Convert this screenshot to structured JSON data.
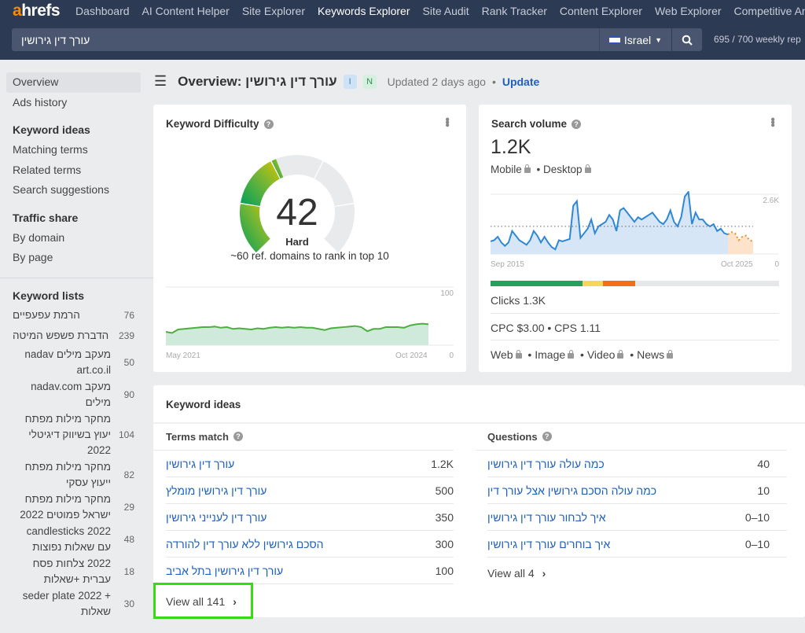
{
  "nav": {
    "logo_a": "a",
    "logo_rest": "hrefs",
    "items": [
      "Dashboard",
      "AI Content Helper",
      "Site Explorer",
      "Keywords Explorer",
      "Site Audit",
      "Rank Tracker",
      "Content Explorer",
      "Web Explorer",
      "Competitive Ana"
    ],
    "active": "Keywords Explorer"
  },
  "search": {
    "value": "עורך דין גירושין",
    "country": "Israel",
    "quota": "695  /  700  weekly rep"
  },
  "sidebar": {
    "top": [
      "Overview",
      "Ads history"
    ],
    "keyword_ideas_heading": "Keyword ideas",
    "keyword_ideas": [
      "Matching terms",
      "Related terms",
      "Search suggestions"
    ],
    "traffic_heading": "Traffic share",
    "traffic": [
      "By domain",
      "By page"
    ],
    "lists_heading": "Keyword lists",
    "lists": [
      {
        "name": "הרמת עפעפיים",
        "count": "76"
      },
      {
        "name": "הדברת פשפש המיטה",
        "count": "239"
      },
      {
        "name": "nadav מעקב מילים art.co.il",
        "count": "50"
      },
      {
        "name": "nadav.com מעקב מילים",
        "count": "90"
      },
      {
        "name": "מחקר מילות מפתח יעוץ בשיווק דיגיטלי 2022",
        "count": "104"
      },
      {
        "name": "מחקר מילות מפתח ייעוץ עסקי",
        "count": "82"
      },
      {
        "name": "מחקר מילות מפתח ישראל פמוטים 2022",
        "count": "29"
      },
      {
        "name": "candlesticks 2022 עם שאלות נפוצות",
        "count": "48"
      },
      {
        "name": "2022 צלחות פסח עברית +שאלות",
        "count": "18"
      },
      {
        "name": "seder plate 2022 + שאלות",
        "count": "30"
      }
    ]
  },
  "header": {
    "title": "Overview: עורך דין גירושין",
    "badge_i": "I",
    "badge_n": "N",
    "updated": "Updated 2 days ago",
    "dot": "•",
    "update_link": "Update"
  },
  "kd": {
    "title": "Keyword Difficulty",
    "value": "42",
    "value_num": 42,
    "label": "Hard",
    "subtitle": "~60 ref. domains to rank in top 10",
    "chart_max": "100",
    "chart_min": "0",
    "x_start": "May 2021",
    "x_end": "Oct 2024",
    "trend": [
      23,
      21,
      27,
      28,
      29,
      30,
      31,
      31,
      32,
      30,
      31,
      28,
      29,
      28,
      27,
      29,
      28,
      30,
      31,
      30,
      31,
      30,
      31,
      30,
      30,
      28,
      26,
      29,
      30,
      31,
      32,
      33,
      31,
      24,
      28,
      28,
      31,
      31,
      31,
      30,
      34,
      36,
      37,
      36
    ]
  },
  "sv": {
    "title": "Search volume",
    "value": "1.2K",
    "mobile": "Mobile",
    "desktop": "Desktop",
    "chart_max": "2.6K",
    "chart_min": "0",
    "x_start": "Sep 2015",
    "x_end": "Oct 2025",
    "average": 1.2,
    "trend": [
      0.55,
      0.6,
      0.75,
      0.5,
      0.35,
      0.5,
      1.0,
      0.8,
      0.6,
      0.5,
      0.4,
      0.6,
      1.0,
      0.8,
      0.5,
      0.75,
      0.5,
      0.3,
      0.2,
      0.6,
      0.55,
      0.6,
      0.65,
      2.1,
      2.3,
      0.7,
      0.9,
      1.1,
      1.5,
      0.9,
      1.2,
      1.3,
      1.4,
      1.7,
      1.5,
      1.0,
      1.9,
      2.0,
      1.8,
      1.6,
      1.4,
      1.6,
      1.5,
      1.6,
      1.7,
      1.8,
      1.6,
      1.4,
      1.3,
      1.5,
      1.9,
      1.4,
      1.2,
      1.6,
      2.5,
      2.7,
      1.3,
      1.8,
      1.5,
      1.5,
      1.3,
      1.2,
      1.3,
      1.0,
      1.1,
      0.9,
      0.85
    ],
    "forecast": [
      0.85,
      0.95,
      0.9,
      0.6,
      0.75,
      0.8,
      0.6,
      0.55
    ],
    "clicks_bar": [
      {
        "color": "#27a05b",
        "share": 0.32
      },
      {
        "color": "#f8d55c",
        "share": 0.07
      },
      {
        "color": "#f46e19",
        "share": 0.11
      },
      {
        "color": "#e6e7ea",
        "share": 0.5
      }
    ],
    "clicks": "Clicks 1.3K",
    "cpc": "CPC $3.00",
    "cps": "CPS 1.11",
    "serp": [
      "Web",
      "Image",
      "Video",
      "News"
    ]
  },
  "ideas": {
    "title": "Keyword ideas",
    "terms_heading": "Terms match",
    "questions_heading": "Questions",
    "terms": [
      {
        "kw": "עורך דין גירושין",
        "v": "1.2K"
      },
      {
        "kw": "עורך דין גירושין מומלץ",
        "v": "500"
      },
      {
        "kw": "עורך דין לענייני גירושין",
        "v": "350"
      },
      {
        "kw": "הסכם גירושין ללא עורך דין להורדה",
        "v": "300"
      },
      {
        "kw": "עורך דין גירושין בתל אביב",
        "v": "100"
      }
    ],
    "questions": [
      {
        "kw": "כמה עולה עורך דין גירושין",
        "v": "40"
      },
      {
        "kw": "כמה עולה הסכם גירושין אצל עורך דין",
        "v": "10"
      },
      {
        "kw": "איך לבחור עורך דין גירושין",
        "v": "0–10"
      },
      {
        "kw": "איך בוחרים עורך דין גירושין",
        "v": "0–10"
      }
    ],
    "terms_view_all": "View all 141",
    "questions_view_all": "View all 4"
  },
  "colors": {
    "nav_bg": "#2c3a54",
    "link": "#1d5fc2",
    "highlight": "#33dd11"
  }
}
